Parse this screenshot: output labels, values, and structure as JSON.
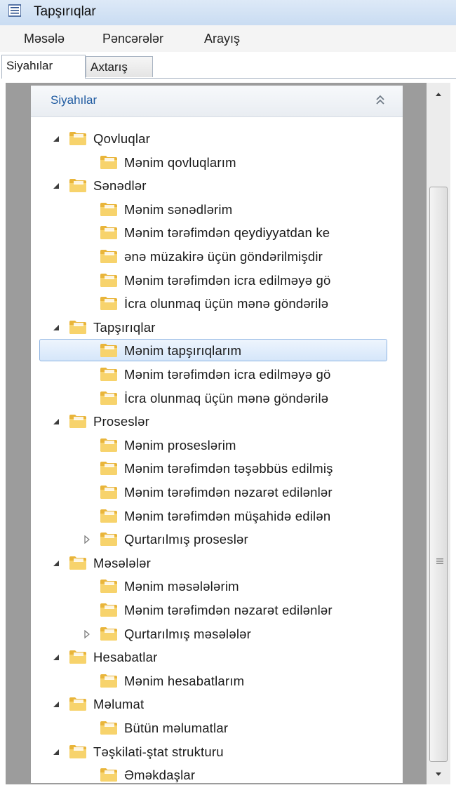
{
  "window": {
    "title": "Tapşırıqlar",
    "icon": "app-list-icon"
  },
  "menu": [
    {
      "label": "Məsələ"
    },
    {
      "label": "Pəncərələr"
    },
    {
      "label": "Arayış"
    }
  ],
  "tabs": [
    {
      "label": "Siyahılar",
      "active": true
    },
    {
      "label": "Axtarış",
      "active": false
    }
  ],
  "panel": {
    "title": "Siyahılar",
    "collapse_icon": "double-chevron-up-icon"
  },
  "tree": [
    {
      "label": "Qovluqlar",
      "level": 0,
      "expander": "expanded"
    },
    {
      "label": "Mənim qovluqlarım",
      "level": 1,
      "expander": "none"
    },
    {
      "label": "Sənədlər",
      "level": 0,
      "expander": "expanded"
    },
    {
      "label": "Mənim sənədlərim",
      "level": 1,
      "expander": "none"
    },
    {
      "label": "Mənim tərəfimdən qeydiyyatdan ke",
      "level": 1,
      "expander": "none"
    },
    {
      "label": "ənə müzakirə üçün göndərilmişdir",
      "level": 1,
      "expander": "none"
    },
    {
      "label": "Mənim tərəfimdən icra edilməyə gö",
      "level": 1,
      "expander": "none"
    },
    {
      "label": "İcra olunmaq üçün mənə göndərilə",
      "level": 1,
      "expander": "none"
    },
    {
      "label": "Tapşırıqlar",
      "level": 0,
      "expander": "expanded"
    },
    {
      "label": "Mənim tapşırıqlarım",
      "level": 1,
      "expander": "none",
      "selected": true
    },
    {
      "label": "Mənim tərəfimdən icra edilməyə gö",
      "level": 1,
      "expander": "none"
    },
    {
      "label": "İcra olunmaq üçün mənə göndərilə",
      "level": 1,
      "expander": "none"
    },
    {
      "label": "Proseslər",
      "level": 0,
      "expander": "expanded"
    },
    {
      "label": "Mənim proseslərim",
      "level": 1,
      "expander": "none"
    },
    {
      "label": "Mənim tərəfimdən təşəbbüs edilmiş",
      "level": 1,
      "expander": "none"
    },
    {
      "label": "Mənim tərəfimdən nəzarət edilənlər",
      "level": 1,
      "expander": "none"
    },
    {
      "label": "Mənim tərəfimdən müşahidə edilən",
      "level": 1,
      "expander": "none"
    },
    {
      "label": "Qurtarılmış proseslər",
      "level": 1,
      "expander": "collapsed"
    },
    {
      "label": "Məsələlər",
      "level": 0,
      "expander": "expanded"
    },
    {
      "label": "Mənim məsələlərim",
      "level": 1,
      "expander": "none"
    },
    {
      "label": "Mənim tərəfimdən nəzarət edilənlər",
      "level": 1,
      "expander": "none"
    },
    {
      "label": "Qurtarılmış məsələlər",
      "level": 1,
      "expander": "collapsed"
    },
    {
      "label": "Hesabatlar",
      "level": 0,
      "expander": "expanded"
    },
    {
      "label": "Mənim hesabatlarım",
      "level": 1,
      "expander": "none"
    },
    {
      "label": "Məlumat",
      "level": 0,
      "expander": "expanded"
    },
    {
      "label": "Bütün məlumatlar",
      "level": 1,
      "expander": "none"
    },
    {
      "label": "Təşkilati-ştat strukturu",
      "level": 0,
      "expander": "expanded"
    },
    {
      "label": "Əməkdaşlar",
      "level": 1,
      "expander": "none"
    }
  ],
  "icons": {
    "folder": "folder-icon",
    "expanded": "expanded-triangle-icon",
    "collapsed": "collapsed-triangle-icon",
    "scroll_up": "scroll-up-arrow-icon",
    "scroll_down": "scroll-down-arrow-icon",
    "scroll_grip": "scroll-grip-icon"
  },
  "colors": {
    "panel_title": "#1e5aa0",
    "selection": "#d5e6fa",
    "frame": "#9c9c9c",
    "folder": "#f2c24a"
  }
}
